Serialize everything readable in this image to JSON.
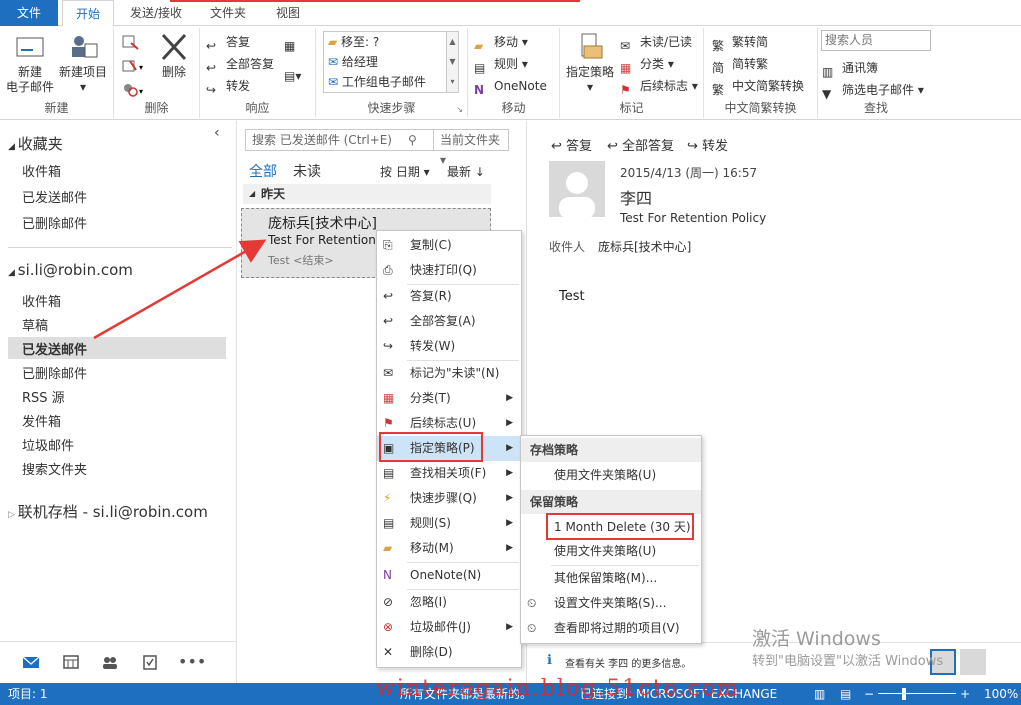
{
  "tabs": [
    {
      "label": "文件"
    },
    {
      "label": "开始"
    },
    {
      "label": "发送/接收"
    },
    {
      "label": "文件夹"
    },
    {
      "label": "视图"
    }
  ],
  "ribbon": {
    "new": {
      "new_email": "新建\n电子邮件",
      "new_item": "新建项目",
      "group": "新建"
    },
    "delete": {
      "delete": "删除",
      "group": "删除"
    },
    "respond": {
      "reply": "答复",
      "reply_all": "全部答复",
      "forward": "转发",
      "group": "响应"
    },
    "quicksteps": {
      "items": [
        "移至: ?",
        "给经理",
        "工作组电子邮件"
      ],
      "group": "快速步骤"
    },
    "move": {
      "move": "移动",
      "rules": "规则",
      "onenote": "OneNote",
      "group": "移动"
    },
    "tags": {
      "assign_policy": "指定策略",
      "unread_read": "未读/已读",
      "categorize": "分类",
      "followup": "后续标志",
      "group": "标记"
    },
    "chinese": {
      "t2s": "繁转简",
      "s2t": "简转繁",
      "convert": "中文简繁转换",
      "group": "中文简繁转换"
    },
    "find": {
      "search_people": "搜索人员",
      "address_book": "通讯簿",
      "filter_email": "筛选电子邮件",
      "group": "查找"
    }
  },
  "folders": {
    "favorites_title": "收藏夹",
    "favorites": [
      "收件箱",
      "已发送邮件",
      "已删除邮件"
    ],
    "account": "si.li@robin.com",
    "account_items": [
      "收件箱",
      "草稿",
      "已发送邮件",
      "已删除邮件",
      "RSS 源",
      "发件箱",
      "垃圾邮件",
      "搜索文件夹"
    ],
    "archive": "联机存档 - si.li@robin.com"
  },
  "msglist": {
    "search_placeholder": "搜索 已发送邮件 (Ctrl+E)",
    "scope": "当前文件夹",
    "tab_all": "全部",
    "tab_unread": "未读",
    "sort_by": "按 日期",
    "sort_order": "最新",
    "date_group": "昨天",
    "item": {
      "from": "庞标兵[技术中心]",
      "subject": "Test For Retention",
      "preview": "Test <结束>"
    }
  },
  "reading": {
    "reply": "答复",
    "reply_all": "全部答复",
    "forward": "转发",
    "date": "2015/4/13 (周一) 16:57",
    "sender": "李四",
    "subject": "Test For Retention Policy",
    "to_label": "收件人",
    "to_value": "庞标兵[技术中心]",
    "body": "Test",
    "people_hint": "查看有关 李四 的更多信息。"
  },
  "context_menu": [
    {
      "label": "复制(C)"
    },
    {
      "label": "快速打印(Q)"
    },
    {
      "label": "答复(R)"
    },
    {
      "label": "全部答复(A)"
    },
    {
      "label": "转发(W)"
    },
    {
      "label": "标记为\"未读\"(N)"
    },
    {
      "label": "分类(T)"
    },
    {
      "label": "后续标志(U)"
    },
    {
      "label": "指定策略(P)"
    },
    {
      "label": "查找相关项(F)"
    },
    {
      "label": "快速步骤(Q)"
    },
    {
      "label": "规则(S)"
    },
    {
      "label": "移动(M)"
    },
    {
      "label": "OneNote(N)"
    },
    {
      "label": "忽略(I)"
    },
    {
      "label": "垃圾邮件(J)"
    },
    {
      "label": "删除(D)"
    }
  ],
  "policy_menu": {
    "archive_head": "存档策略",
    "archive_items": [
      "使用文件夹策略(U)"
    ],
    "retention_head": "保留策略",
    "retention_items": [
      "1 Month Delete (30 天)",
      "使用文件夹策略(U)"
    ],
    "other_items": [
      "其他保留策略(M)...",
      "设置文件夹策略(S)...",
      "查看即将过期的项目(V)"
    ]
  },
  "status": {
    "items": "项目: 1",
    "sync": "所有文件夹都是最新的。",
    "connection": "已连接到: MICROSOFT EXCHANGE",
    "zoom": "100%"
  },
  "watermark": {
    "line1": "激活 Windows",
    "line2": "转到\"电脑设置\"以激活 Windows",
    "blog": "winteragain.blog.51cto.com"
  },
  "colors": {
    "accent": "#1e6fbf",
    "highlight": "#e53935",
    "menu_hover": "#cde3f7"
  }
}
